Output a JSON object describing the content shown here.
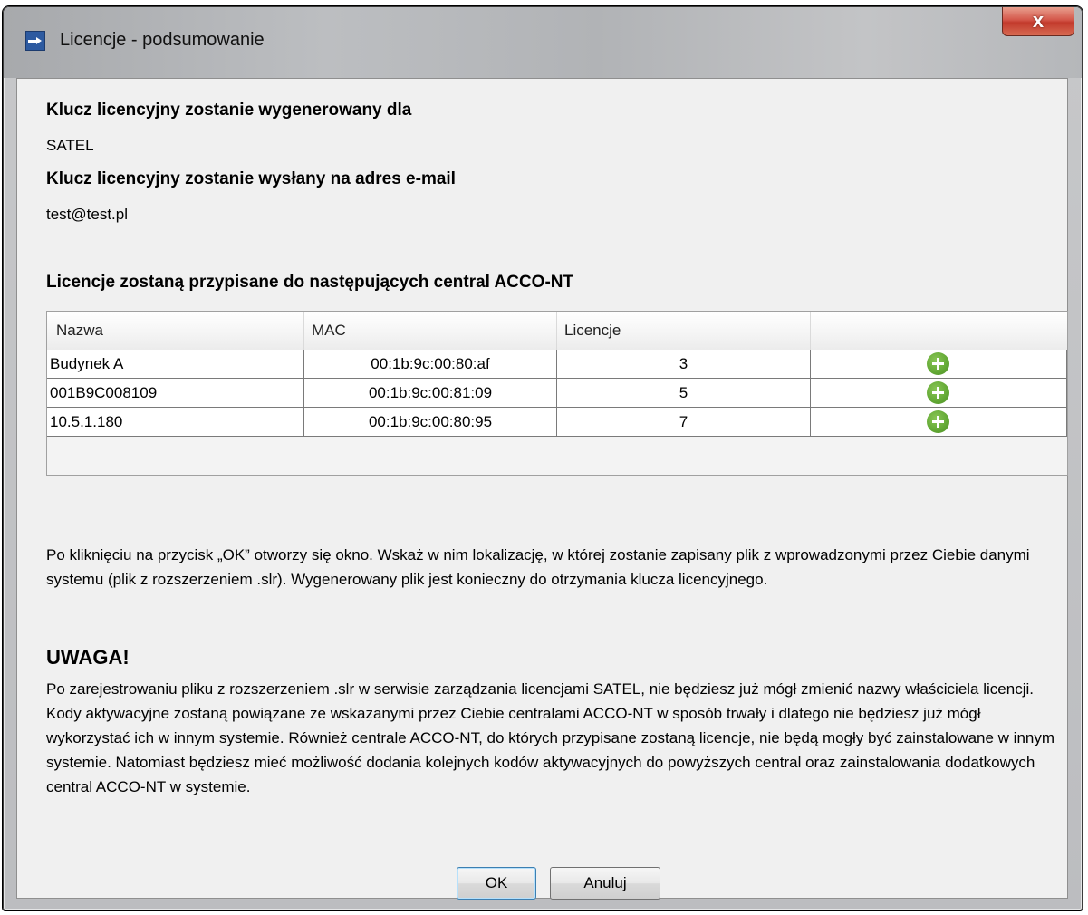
{
  "window": {
    "title": "Licencje - podsumowanie",
    "close_glyph": "x"
  },
  "sections": {
    "owner_heading": "Klucz licencyjny zostanie wygenerowany dla",
    "owner_value": "SATEL",
    "email_heading": "Klucz licencyjny zostanie wysłany na adres e-mail",
    "email_value": "test@test.pl",
    "table_heading": "Licencje zostaną przypisane do następujących central ACCO-NT"
  },
  "table": {
    "columns": [
      "Nazwa",
      "MAC",
      "Licencje",
      ""
    ],
    "rows": [
      {
        "name": "Budynek A",
        "mac": "00:1b:9c:00:80:af",
        "licenses": "3",
        "action_icon": "plus-icon"
      },
      {
        "name": "001B9C008109",
        "mac": "00:1b:9c:00:81:09",
        "licenses": "5",
        "action_icon": "plus-icon"
      },
      {
        "name": "10.5.1.180",
        "mac": "00:1b:9c:00:80:95",
        "licenses": "7",
        "action_icon": "plus-icon"
      }
    ]
  },
  "info_text": "Po kliknięciu na przycisk „OK” otworzy się okno. Wskaż w nim lokalizację, w której zostanie zapisany plik z wprowadzonymi przez Ciebie danymi systemu (plik z rozszerzeniem .slr). Wygenerowany plik jest konieczny do otrzymania klucza licencyjnego.",
  "warning": {
    "title": "UWAGA!",
    "text": "Po zarejestrowaniu pliku z rozszerzeniem .slr w serwisie zarządzania licencjami SATEL, nie będziesz już mógł zmienić nazwy właściciela licencji. Kody aktywacyjne zostaną powiązane ze wskazanymi przez Ciebie centralami ACCO-NT w sposób trwały i dlatego nie będziesz już mógł wykorzystać ich w innym systemie. Również centrale ACCO-NT, do których przypisane zostaną licencje, nie będą mogły być zainstalowane w innym systemie. Natomiast będziesz mieć możliwość dodania kolejnych kodów aktywacyjnych do powyższych central oraz zainstalowania dodatkowych central ACCO-NT w systemie."
  },
  "buttons": {
    "ok": "OK",
    "cancel": "Anuluj"
  },
  "colors": {
    "add_icon": "#62a834",
    "close_button": "#c9473a"
  }
}
